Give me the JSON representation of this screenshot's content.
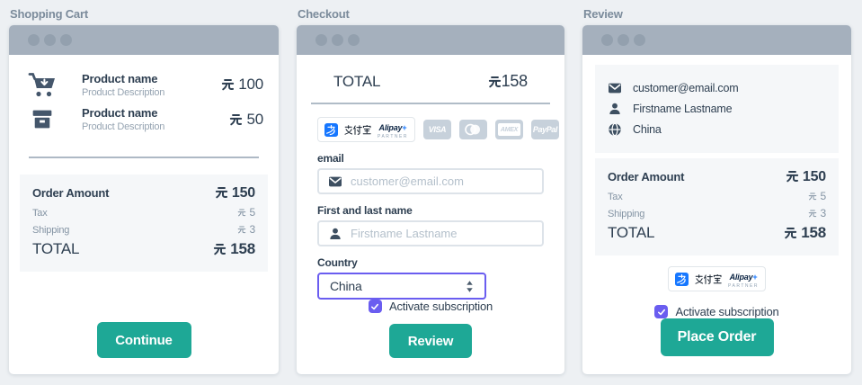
{
  "currency_symbol": "元",
  "colors": {
    "accent_teal": "#1EA896",
    "accent_purple": "#6A5DF0",
    "alipay_blue": "#1677FF",
    "window_bar": "#A5B0BD",
    "page_background": "#EDF0F3"
  },
  "cart": {
    "title": "Shopping Cart",
    "items": [
      {
        "name": "Product name",
        "description": "Product Description",
        "price": "100"
      },
      {
        "name": "Product name",
        "description": "Product Description",
        "price": "50"
      }
    ],
    "summary": {
      "order_label": "Order Amount",
      "order_value": "150",
      "tax_label": "Tax",
      "tax_value": "5",
      "shipping_label": "Shipping",
      "shipping_value": "3",
      "total_label": "TOTAL",
      "total_value": "158"
    },
    "continue_button": "Continue"
  },
  "checkout": {
    "title": "Checkout",
    "total_label": "TOTAL",
    "total_value": "158",
    "alipay": {
      "cn": "支付宝",
      "wordmark": "Alipay",
      "plus": "+",
      "partner": "PARTNER"
    },
    "payments": {
      "visa": "VISA",
      "amex": "AMEX",
      "paypal": "PayPal"
    },
    "email_label": "email",
    "email_placeholder": "customer@email.com",
    "name_label": "First and last name",
    "name_placeholder": "Firstname Lastname",
    "country_label": "Country",
    "country_value": "China",
    "subscription_label": "Activate subscription",
    "subscription_checked": true,
    "review_button": "Review"
  },
  "review": {
    "title": "Review",
    "customer_email": "customer@email.com",
    "customer_name": "Firstname Lastname",
    "customer_country": "China",
    "summary": {
      "order_label": "Order Amount",
      "order_value": "150",
      "tax_label": "Tax",
      "tax_value": "5",
      "shipping_label": "Shipping",
      "shipping_value": "3",
      "total_label": "TOTAL",
      "total_value": "158"
    },
    "alipay": {
      "cn": "支付宝",
      "wordmark": "Alipay",
      "plus": "+",
      "partner": "PARTNER"
    },
    "subscription_label": "Activate subscription",
    "subscription_checked": true,
    "place_order_button": "Place Order"
  }
}
